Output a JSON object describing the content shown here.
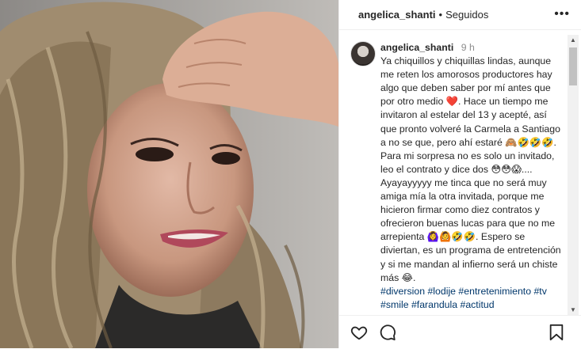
{
  "post": {
    "username": "angelica_shanti",
    "separator": "•",
    "follow_status": "Seguidos",
    "more_icon": "ellipsis-icon"
  },
  "caption": {
    "username": "angelica_shanti",
    "time": "9 h",
    "text": "Ya chiquillos y chiquillas lindas, aunque me reten los amorosos productores hay algo que deben saber por mí antes que por otro medio ❤️. Hace un tiempo me invitaron al estelar del 13 y acepté, así que pronto volveré la Carmela a Santiago a no se que, pero ahí estaré 🙈🤣🤣🤣. Para mi sorpresa no es solo un invitado, leo el contrato y dice dos 😳😳😱.... Ayayayyyyy me tinca que no será muy amiga mía la otra invitada, porque me hicieron firmar como diez contratos y ofrecieron buenas lucas para que no me arrepienta 🙆‍♀️🙆🤣🤣. Espero se diviertan, es un programa de entretención y si me mandan al infierno será un chiste más 😂.",
    "hashtags": "#diversion #lodije #entretenimiento #tv #smile #farandula #actitud"
  },
  "actions": {
    "like_icon": "heart-icon",
    "comment_icon": "comment-icon",
    "save_icon": "bookmark-icon"
  }
}
